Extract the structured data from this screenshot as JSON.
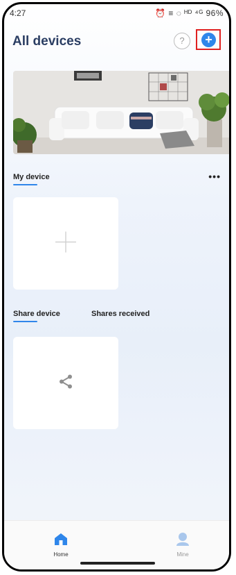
{
  "status_bar": {
    "time": "4:27",
    "indicators": "⏰ ≡ ◌ ᴴᴰ ⁴ᴳ 96%"
  },
  "header": {
    "title": "All devices",
    "help_label": "?",
    "add_label": "+"
  },
  "my_device": {
    "title": "My device",
    "more_label": "•••",
    "add_card_icon": "plus-icon"
  },
  "share": {
    "tabs": [
      "Share device",
      "Shares received"
    ],
    "card_icon": "share-icon"
  },
  "tabbar": {
    "home_label": "Home",
    "mine_label": "Mine"
  },
  "colors": {
    "accent": "#2f86ea",
    "title": "#2b3e63",
    "highlight": "#e02020"
  }
}
